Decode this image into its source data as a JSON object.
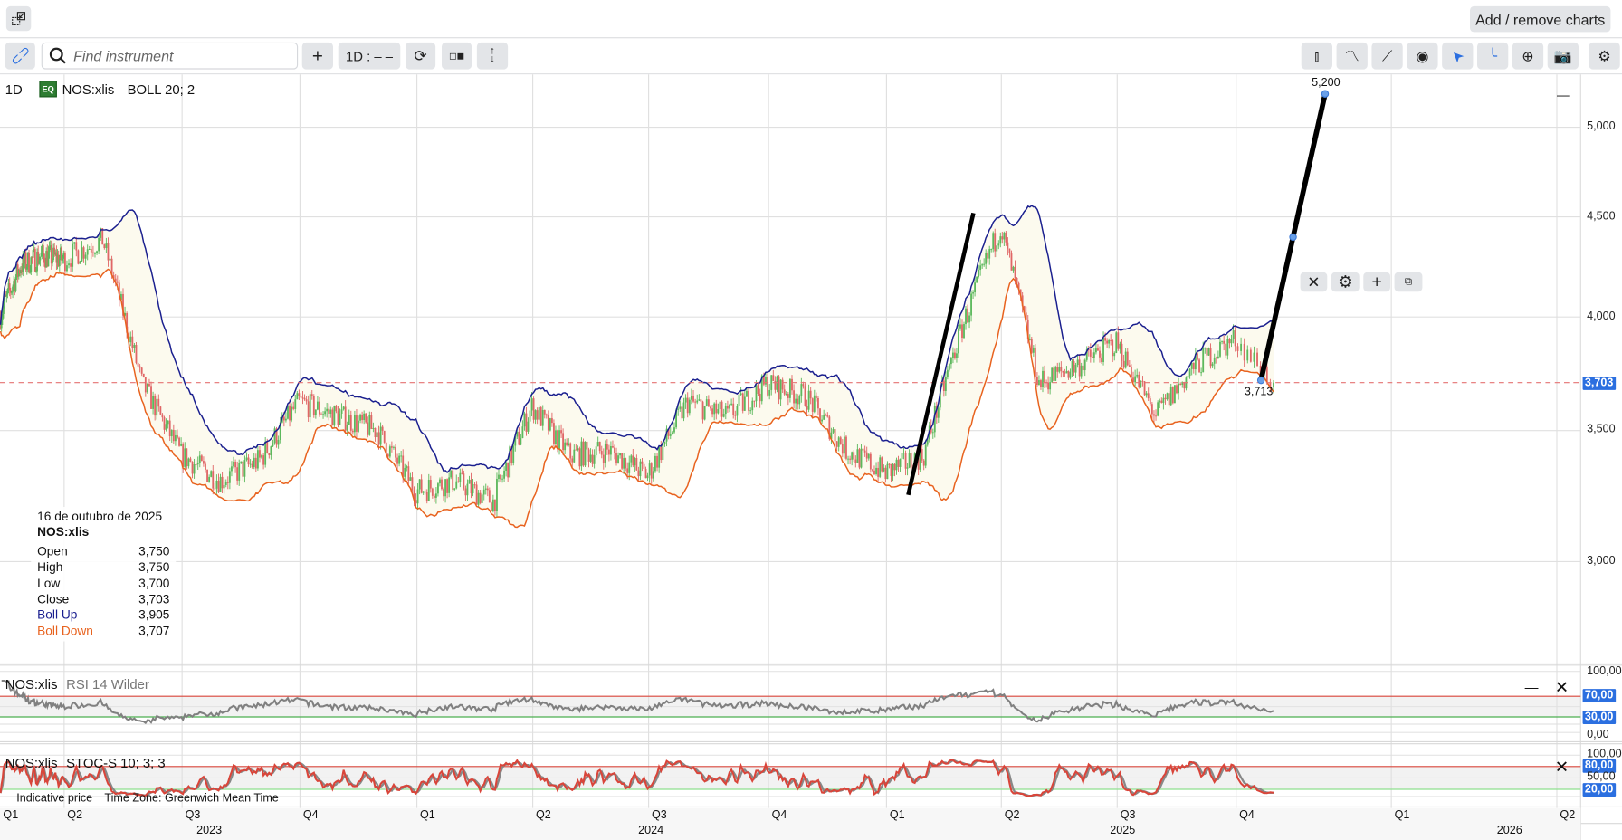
{
  "topbar": {
    "add_remove_label": "Add / remove charts"
  },
  "toolbar": {
    "search_placeholder": "Find instrument",
    "add_label": "+",
    "interval_label": "1D : – –",
    "left_icons": [
      "link-icon",
      "search-icon",
      "plus-icon",
      "interval",
      "refresh-icon",
      "layout-icon",
      "vertical-arrows-icon"
    ],
    "right_icons": [
      "candlestick-icon",
      "indicators-icon",
      "trendline-icon",
      "eye-icon",
      "cursor-arrow-icon",
      "curve-icon",
      "zoom-in-icon",
      "camera-icon",
      "gear-icon"
    ],
    "active_icons": [
      "cursor-arrow-icon",
      "curve-icon"
    ]
  },
  "main": {
    "interval": "1D",
    "badge": "EQ",
    "instrument": "NOS:xlis",
    "indicator": "BOLL 20; 2",
    "price_labels": [
      "5,000",
      "4,500",
      "4,000",
      "3,500",
      "3,000"
    ],
    "last_price": "3,703",
    "trendline_labels": {
      "end": "5,200",
      "start": "3,713"
    },
    "legend": {
      "date": "16 de outubro de 2025",
      "instrument": "NOS:xlis",
      "rows": [
        {
          "k": "Open",
          "v": "3,750"
        },
        {
          "k": "High",
          "v": "3,750"
        },
        {
          "k": "Low",
          "v": "3,700"
        },
        {
          "k": "Close",
          "v": "3,703"
        },
        {
          "k": "Boll Up",
          "v": "3,905"
        },
        {
          "k": "Boll Down",
          "v": "3,707"
        }
      ]
    }
  },
  "rsi": {
    "instrument": "NOS:xlis",
    "indicator": "RSI 14 Wilder",
    "labels": [
      "100,00",
      "70,00",
      "30,00",
      "0,00"
    ]
  },
  "stoch": {
    "instrument": "NOS:xlis",
    "indicator": "STOC-S 10; 3; 3",
    "labels": [
      "100,00",
      "80,00",
      "50,00",
      "20,00"
    ]
  },
  "footer": {
    "indicative": "Indicative price",
    "timezone": "Time Zone: Greenwich Mean Time"
  },
  "xaxis": {
    "quarters": [
      "Q1",
      "Q2",
      "Q3",
      "Q4",
      "Q1",
      "Q2",
      "Q3",
      "Q4",
      "Q1",
      "Q2",
      "Q3",
      "Q4",
      "Q1",
      "Q2"
    ],
    "years": [
      "2023",
      "2024",
      "2025",
      "2026"
    ]
  },
  "colors": {
    "accent": "#2b6fe0",
    "boll_up": "#1a1f8f",
    "boll_down": "#e8621e",
    "up": "#5cb85c",
    "down": "#e06666",
    "rsi_line": "#808080",
    "stoch_k": "#d9453a",
    "stoch_d": "#888888",
    "upper_level": "#d9453a",
    "lower_level": "#4caf50"
  },
  "chart_data": {
    "type": "candlestick",
    "scale": "log",
    "ylim": [
      2800,
      5300
    ],
    "months": [
      "2023-01",
      "2023-02",
      "2023-03",
      "2023-04",
      "2023-05",
      "2023-06",
      "2023-07",
      "2023-08",
      "2023-09",
      "2023-10",
      "2023-11",
      "2023-12",
      "2024-01",
      "2024-02",
      "2024-03",
      "2024-04",
      "2024-05",
      "2024-06",
      "2024-07",
      "2024-08",
      "2024-09",
      "2024-10",
      "2024-11",
      "2024-12",
      "2025-01",
      "2025-02",
      "2025-03",
      "2025-04",
      "2025-05",
      "2025-06",
      "2025-07",
      "2025-08",
      "2025-09",
      "2025-10"
    ],
    "approx_month_close": [
      4250,
      4300,
      4280,
      4380,
      3700,
      3400,
      3300,
      3380,
      3620,
      3560,
      3500,
      3260,
      3300,
      3220,
      3600,
      3400,
      3420,
      3320,
      3620,
      3560,
      3700,
      3640,
      3420,
      3330,
      3400,
      3950,
      4450,
      3700,
      3780,
      3880,
      3560,
      3780,
      3900,
      3703
    ],
    "last_bar": {
      "date": "2025-10-16",
      "open": 3750,
      "high": 3750,
      "low": 3700,
      "close": 3703
    },
    "bollinger": {
      "period": 20,
      "stddev": 2
    },
    "rsi": {
      "period": 14,
      "levels": [
        70,
        30
      ]
    },
    "stochastic": {
      "k": 10,
      "smooth": 3,
      "d": 3,
      "levels": [
        80,
        20
      ]
    },
    "trendlines": [
      {
        "from": 3245,
        "to": 4520
      },
      {
        "from": 3713,
        "to": 5200
      }
    ]
  }
}
